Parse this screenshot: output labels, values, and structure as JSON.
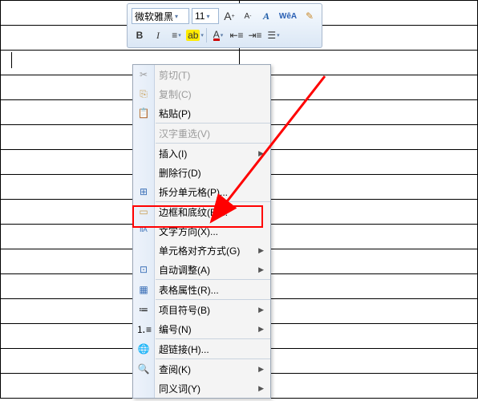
{
  "toolbar": {
    "font_name": "微软雅黑",
    "font_size": "11",
    "grow_a": "A",
    "shrink_a": "A",
    "style_a": "A",
    "wordart": "WêA",
    "format_painter": "✎",
    "bold": "B",
    "italic": "I",
    "align": "≡",
    "highlight": "ab",
    "font_color": "A",
    "indent_dec": "≡",
    "indent_inc": "≡",
    "list": "≡"
  },
  "menu": {
    "cut": "剪切(T)",
    "copy": "复制(C)",
    "paste": "粘贴(P)",
    "hanzi": "汉字重选(V)",
    "insert": "插入(I)",
    "delete_row": "删除行(D)",
    "split_cell": "拆分单元格(P)...",
    "border_shade": "边框和底纹(B)...",
    "text_dir": "文字方向(X)...",
    "cell_align": "单元格对齐方式(G)",
    "autofit": "自动调整(A)",
    "table_prop": "表格属性(R)...",
    "bullets": "项目符号(B)",
    "numbering": "编号(N)",
    "hyperlink": "超链接(H)...",
    "lookup": "查阅(K)",
    "synonym": "同义词(Y)"
  }
}
